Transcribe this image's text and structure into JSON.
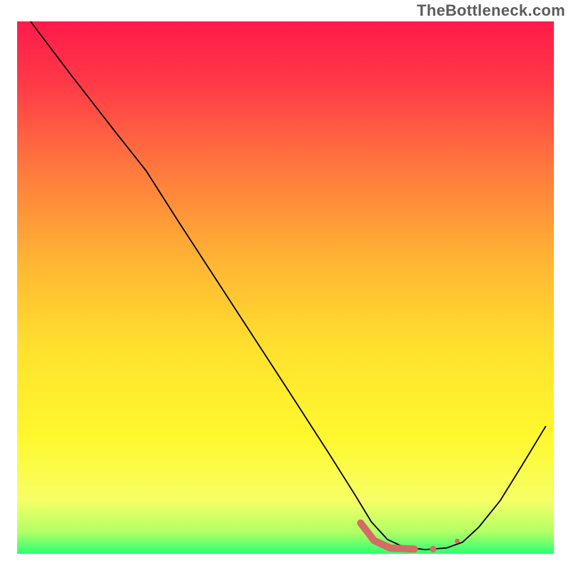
{
  "watermark": "TheBottleneck.com",
  "chart_data": {
    "type": "line",
    "title": "",
    "xlabel": "",
    "ylabel": "",
    "xlim": [
      0,
      100
    ],
    "ylim": [
      0,
      100
    ],
    "background": {
      "gradient_stops": [
        {
          "offset": 0.0,
          "color": "#ff1a4b"
        },
        {
          "offset": 0.12,
          "color": "#ff3b47"
        },
        {
          "offset": 0.28,
          "color": "#ff7a3d"
        },
        {
          "offset": 0.46,
          "color": "#ffb833"
        },
        {
          "offset": 0.62,
          "color": "#ffe22e"
        },
        {
          "offset": 0.78,
          "color": "#fff82e"
        },
        {
          "offset": 0.9,
          "color": "#f6ff66"
        },
        {
          "offset": 0.96,
          "color": "#b0ff66"
        },
        {
          "offset": 1.0,
          "color": "#2bff73"
        }
      ]
    },
    "series": [
      {
        "name": "curve",
        "type": "line",
        "color": "#000000",
        "width": 1.8,
        "points": [
          {
            "x": 2.5,
            "y": 100.0
          },
          {
            "x": 10.0,
            "y": 90.0
          },
          {
            "x": 18.5,
            "y": 79.0
          },
          {
            "x": 24.0,
            "y": 72.0
          },
          {
            "x": 30.0,
            "y": 62.5
          },
          {
            "x": 40.0,
            "y": 47.0
          },
          {
            "x": 50.0,
            "y": 31.5
          },
          {
            "x": 58.0,
            "y": 19.0
          },
          {
            "x": 63.0,
            "y": 11.0
          },
          {
            "x": 66.0,
            "y": 6.0
          },
          {
            "x": 69.0,
            "y": 2.7
          },
          {
            "x": 72.0,
            "y": 1.3
          },
          {
            "x": 76.0,
            "y": 0.8
          },
          {
            "x": 80.0,
            "y": 1.1
          },
          {
            "x": 83.0,
            "y": 2.2
          },
          {
            "x": 86.0,
            "y": 5.0
          },
          {
            "x": 90.0,
            "y": 10.0
          },
          {
            "x": 94.0,
            "y": 16.5
          },
          {
            "x": 98.5,
            "y": 24.0
          }
        ]
      },
      {
        "name": "highlight-segment",
        "type": "line",
        "color": "#d66b66",
        "width": 10,
        "cap": "round",
        "points": [
          {
            "x": 64.0,
            "y": 5.8
          },
          {
            "x": 66.5,
            "y": 2.5
          },
          {
            "x": 69.5,
            "y": 1.1
          },
          {
            "x": 74.0,
            "y": 0.9
          }
        ]
      },
      {
        "name": "highlight-dot-1",
        "type": "scatter",
        "color": "#d66b66",
        "radius": 4.5,
        "points": [
          {
            "x": 77.5,
            "y": 0.9
          }
        ]
      },
      {
        "name": "highlight-dot-2",
        "type": "scatter",
        "color": "#d66b66",
        "radius": 3.5,
        "points": [
          {
            "x": 82.0,
            "y": 2.4
          }
        ]
      }
    ]
  }
}
